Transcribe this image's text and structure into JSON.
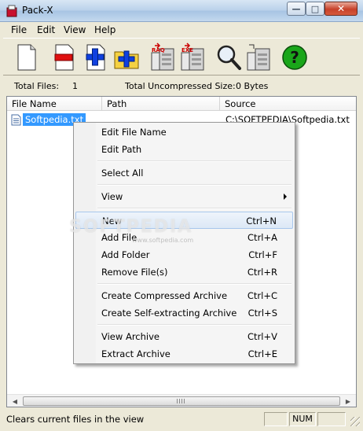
{
  "window": {
    "title": "Pack-X"
  },
  "menu": [
    "File",
    "Edit",
    "View",
    "Help"
  ],
  "toolbar_icons": [
    "new-file-icon",
    "remove-file-icon",
    "add-file-icon",
    "add-folder-icon",
    "create-compressed-archive-icon",
    "create-self-extracting-archive-icon",
    "search-icon",
    "extract-archive-icon",
    "help-icon"
  ],
  "info": {
    "total_files_label": "Total Files:",
    "total_files_value": "1",
    "total_size_label": "Total Uncompressed Size:",
    "total_size_value": "0 Bytes"
  },
  "table": {
    "columns": [
      "File Name",
      "Path",
      "Source"
    ],
    "rows": [
      {
        "file_name": "Softpedia.txt",
        "path": "",
        "source": "C:\\SOFTPEDIA\\Softpedia.txt"
      }
    ]
  },
  "context_menu": {
    "items": [
      {
        "label": "Edit File Name",
        "shortcut": ""
      },
      {
        "label": "Edit Path",
        "shortcut": ""
      },
      {
        "label": "Select All",
        "shortcut": ""
      },
      {
        "label": "View",
        "shortcut": ""
      },
      {
        "label": "New",
        "shortcut": "Ctrl+N"
      },
      {
        "label": "Add File",
        "shortcut": "Ctrl+A"
      },
      {
        "label": "Add Folder",
        "shortcut": "Ctrl+F"
      },
      {
        "label": "Remove File(s)",
        "shortcut": "Ctrl+R"
      },
      {
        "label": "Create Compressed Archive",
        "shortcut": "Ctrl+C"
      },
      {
        "label": "Create Self-extracting Archive",
        "shortcut": "Ctrl+S"
      },
      {
        "label": "View Archive",
        "shortcut": "Ctrl+V"
      },
      {
        "label": "Extract Archive",
        "shortcut": "Ctrl+E"
      }
    ]
  },
  "status": {
    "text": "Clears current files in the view",
    "num": "NUM"
  },
  "watermark": {
    "main": "SOFTPEDIA",
    "sub": "www.softpedia.com"
  },
  "colors": {
    "selection": "#3399ff",
    "menu_highlight": "#dce8f6"
  }
}
